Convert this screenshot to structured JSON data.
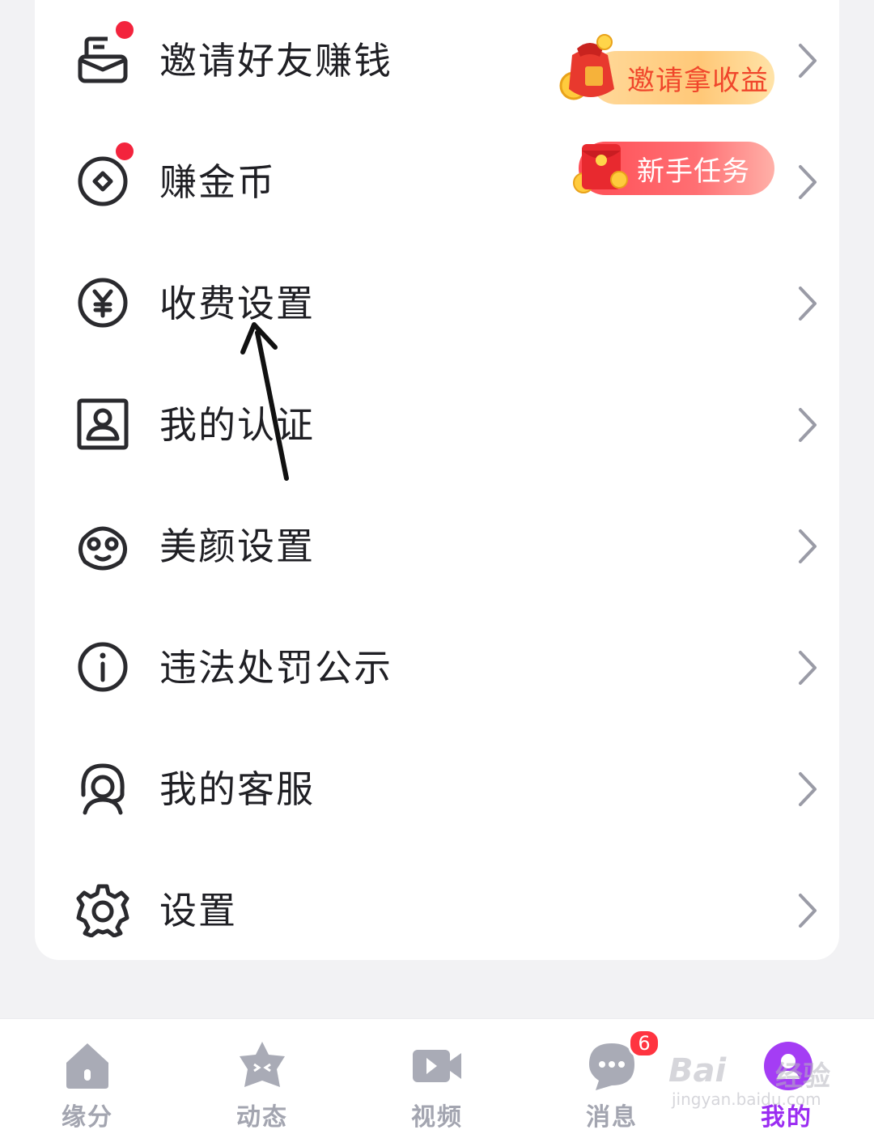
{
  "menu": {
    "items": [
      {
        "label": "邀请好友赚钱",
        "icon": "invite-envelope-icon",
        "has_dot": true,
        "promo": "邀请拿收益"
      },
      {
        "label": "赚金币",
        "icon": "coin-icon",
        "has_dot": true,
        "promo": "新手任务"
      },
      {
        "label": "收费设置",
        "icon": "yuan-icon",
        "has_dot": false
      },
      {
        "label": "我的认证",
        "icon": "id-card-icon",
        "has_dot": false
      },
      {
        "label": "美颜设置",
        "icon": "beauty-face-icon",
        "has_dot": false
      },
      {
        "label": "违法处罚公示",
        "icon": "info-icon",
        "has_dot": false
      },
      {
        "label": "我的客服",
        "icon": "customer-service-icon",
        "has_dot": false
      },
      {
        "label": "设置",
        "icon": "gear-icon",
        "has_dot": false
      }
    ]
  },
  "tabs": [
    {
      "label": "缘分",
      "icon": "house-icon"
    },
    {
      "label": "动态",
      "icon": "star-face-icon"
    },
    {
      "label": "视频",
      "icon": "video-camera-icon"
    },
    {
      "label": "消息",
      "icon": "chat-bubble-icon",
      "badge": "6"
    },
    {
      "label": "我的",
      "icon": "profile-icon",
      "active": true
    }
  ],
  "watermark": {
    "brand": "Bai",
    "brand_cn": "经验",
    "url": "jingyan.baidu.com"
  },
  "colors": {
    "accent": "#9b2df2",
    "dot": "#f3243d",
    "invite_text": "#f0462b"
  }
}
